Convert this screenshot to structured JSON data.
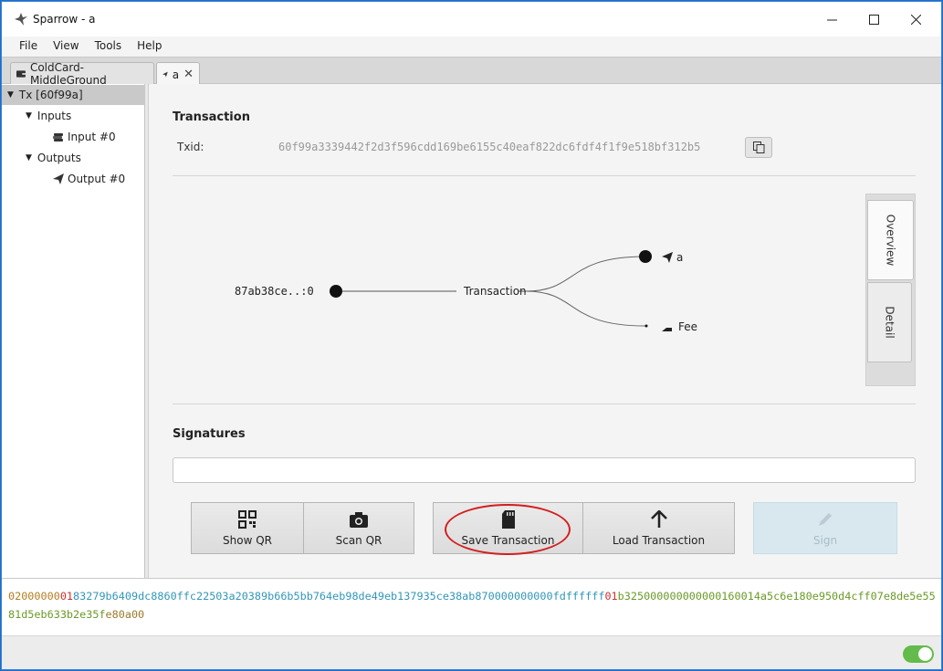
{
  "window": {
    "title": "Sparrow - a"
  },
  "menu": [
    "File",
    "View",
    "Tools",
    "Help"
  ],
  "tabs": [
    {
      "label": "ColdCard-MiddleGround",
      "icon": "wallet-icon"
    },
    {
      "label": "a",
      "icon": "send-icon",
      "close": "✕"
    }
  ],
  "tree": {
    "tx": "Tx [60f99a]",
    "inputs": "Inputs",
    "input0": "Input #0",
    "outputs": "Outputs",
    "output0": "Output #0"
  },
  "transaction": {
    "heading": "Transaction",
    "txid_label": "Txid:",
    "txid": "60f99a3339442f2d3f596cdd169be6155c40eaf822dc6fdf4f1f9e518bf312b5"
  },
  "diagram": {
    "input_label": "87ab38ce..:0",
    "center_label": "Transaction",
    "output_label": "a",
    "fee_label": "Fee"
  },
  "side_tabs": [
    "Overview",
    "Detail"
  ],
  "signatures": {
    "heading": "Signatures"
  },
  "buttons": {
    "show_qr": "Show QR",
    "scan_qr": "Scan QR",
    "save_transaction": "Save Transaction",
    "load_transaction": "Load Transaction",
    "sign": "Sign"
  },
  "hex": {
    "version": "02000000",
    "input_count": "01",
    "input": "83279b6409dc8860ffc22503a20389b66b5bb764eb98de49eb137935ce38ab870000000000fdffffff",
    "output_count": "01",
    "output": "b325000000000000160014a5c6e180e950d4cff07e8de5e5581d5eb633b2e35f",
    "locktime": "e80a00"
  },
  "colors": {
    "accent": "#d41e1e",
    "toggle": "#63bb4b",
    "disabled": "#d9e8ef"
  }
}
